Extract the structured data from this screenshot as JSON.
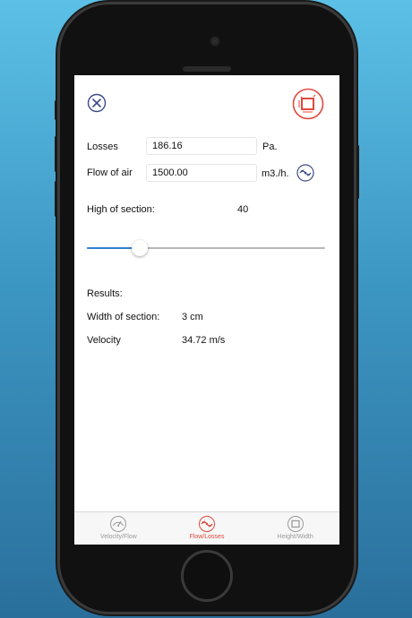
{
  "colors": {
    "accent_blue": "#2e7fd0",
    "accent_red": "#e0483e",
    "icon_navy": "#3b4a8a"
  },
  "header": {
    "close_icon": "close-icon",
    "mode_icon": "section-square-icon"
  },
  "form": {
    "losses_label": "Losses",
    "losses_value": "186.16",
    "losses_unit": "Pa.",
    "flow_label": "Flow of air",
    "flow_value": "1500.00",
    "flow_unit": "m3./h.",
    "flow_icon": "fan-icon",
    "high_label": "High of section:",
    "high_value": "40"
  },
  "slider": {
    "fraction": 0.22
  },
  "results": {
    "title": "Results:",
    "width_label": "Width of section:",
    "width_value": "3 cm",
    "velocity_label": "Velocity",
    "velocity_value": "34.72 m/s"
  },
  "tabs": [
    {
      "label": "Velocity/Flow",
      "icon": "gauge-icon",
      "active": false
    },
    {
      "label": "Flow/Losses",
      "icon": "fan-icon",
      "active": true
    },
    {
      "label": "Height/Width",
      "icon": "square-frame-icon",
      "active": false
    }
  ]
}
